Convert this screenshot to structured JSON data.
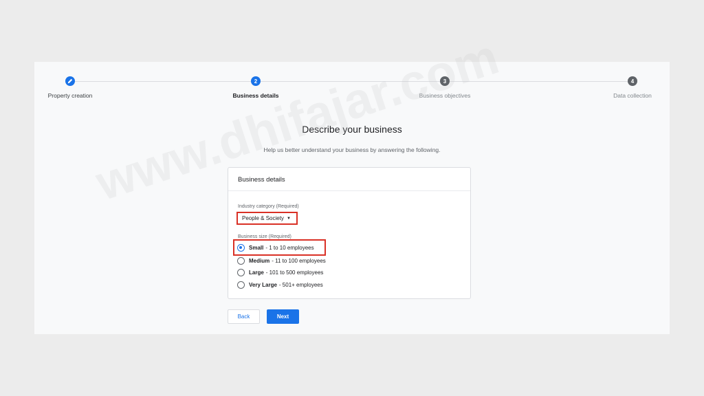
{
  "stepper": {
    "steps": [
      {
        "number": "",
        "label": "Property creation",
        "state": "done",
        "icon": "pencil-icon"
      },
      {
        "number": "2",
        "label": "Business details",
        "state": "current"
      },
      {
        "number": "3",
        "label": "Business objectives",
        "state": "future"
      },
      {
        "number": "4",
        "label": "Data collection",
        "state": "future"
      }
    ]
  },
  "main": {
    "title": "Describe your business",
    "subtitle": "Help us better understand your business by answering the following."
  },
  "card": {
    "header": "Business details",
    "industry_label": "Industry category (Required)",
    "industry_value": "People & Society",
    "size_label": "Business size (Required)",
    "sizes": [
      {
        "name": "Small",
        "detail": "- 1 to 10 employees",
        "checked": true
      },
      {
        "name": "Medium",
        "detail": "- 11 to 100 employees",
        "checked": false
      },
      {
        "name": "Large",
        "detail": "- 101 to 500 employees",
        "checked": false
      },
      {
        "name": "Very Large",
        "detail": "- 501+ employees",
        "checked": false
      }
    ]
  },
  "buttons": {
    "back": "Back",
    "next": "Next"
  },
  "watermark": "www.dhifajar.com",
  "colors": {
    "accent": "#1a73e8",
    "highlight": "#d93025"
  }
}
